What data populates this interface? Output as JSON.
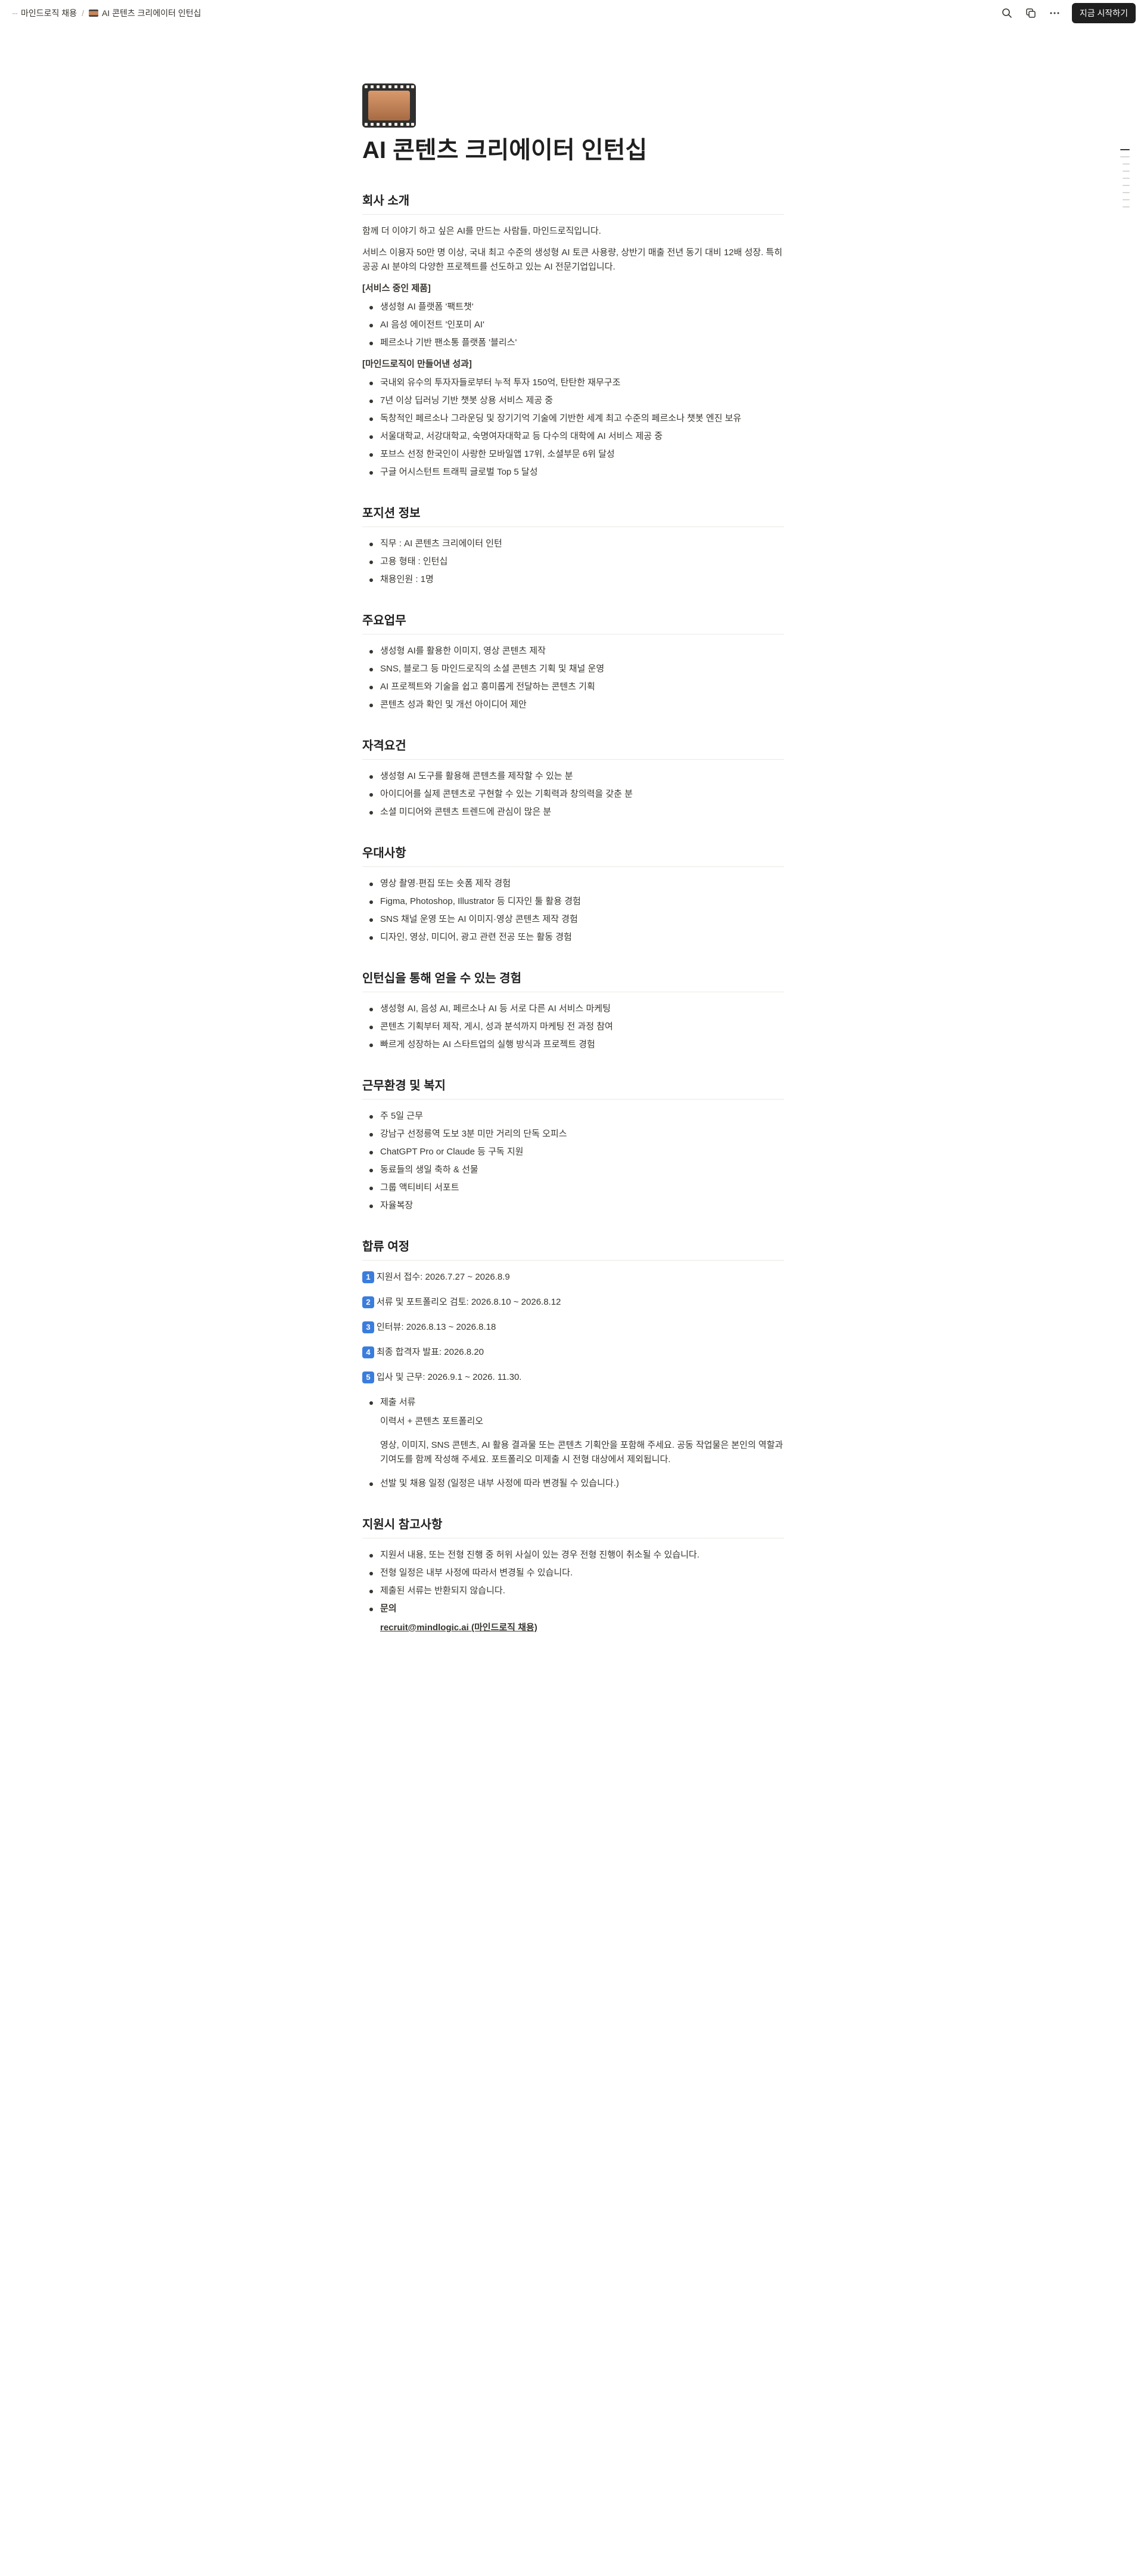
{
  "topbar": {
    "workspace": "마인드로직 채용",
    "page": "AI 콘텐츠 크리에이터 인턴십",
    "start_label": "지금 시작하기"
  },
  "page": {
    "title": "AI 콘텐츠 크리에이터 인턴십"
  },
  "company": {
    "heading": "회사 소개",
    "intro1": "함께 더 이야기 하고 싶은 AI를 만드는 사람들, 마인드로직입니다.",
    "intro2": "서비스 이용자 50만 명 이상, 국내 최고 수준의 생성형 AI 토큰 사용량, 상반기 매출 전년 동기 대비 12배 성장. 특히 공공 AI 분야의 다양한 프로젝트를 선도하고 있는 AI 전문기업입니다.",
    "services_label": "[서비스 중인 제품]",
    "services": [
      "생성형 AI 플랫폼 '팩트챗'",
      "AI 음성 에이전트 '인포미 AI'",
      "페르소나 기반 팬소통 플랫폼 '블리스'"
    ],
    "achievements_label": "[마인드로직이 만들어낸 성과]",
    "achievements": [
      "국내외 유수의 투자자들로부터 누적 투자 150억, 탄탄한 재무구조",
      "7년 이상 딥러닝 기반 챗봇 상용 서비스 제공 중",
      "독창적인 페르소나 그라운딩 및 장기기억 기술에 기반한 세계 최고 수준의 페르소나 챗봇 엔진 보유",
      "서울대학교, 서강대학교, 숙명여자대학교 등 다수의 대학에 AI 서비스 제공 중",
      "포브스 선정 한국인이 사랑한 모바일앱 17위, 소셜부문 6위 달성",
      "구글 어시스턴트 트래픽 글로벌 Top 5 달성"
    ]
  },
  "position": {
    "heading": "포지션 정보",
    "items": [
      "직무 : AI 콘텐츠 크리에이터 인턴",
      "고용 형태 : 인턴십",
      "채용인원 : 1명"
    ]
  },
  "duties": {
    "heading": "주요업무",
    "items": [
      "생성형 AI를 활용한 이미지, 영상 콘텐츠 제작",
      "SNS, 블로그 등 마인드로직의 소셜 콘텐츠 기획 및 채널 운영",
      "AI 프로젝트와 기술을 쉽고 흥미롭게 전달하는 콘텐츠 기획",
      "콘텐츠 성과 확인 및 개선 아이디어 제안"
    ]
  },
  "requirements": {
    "heading": "자격요건",
    "items": [
      "생성형 AI 도구를 활용해 콘텐츠를 제작할 수 있는 분",
      "아이디어를 실제 콘텐츠로 구현할 수 있는 기획력과 창의력을 갖춘 분",
      "소셜 미디어와 콘텐츠 트렌드에 관심이 많은 분"
    ]
  },
  "preferred": {
    "heading": "우대사항",
    "items": [
      "영상 촬영·편집 또는 숏폼 제작 경험",
      "Figma, Photoshop, Illustrator 등 디자인 툴 활용 경험",
      "SNS 채널 운영 또는 AI 이미지·영상 콘텐츠 제작 경험",
      "디자인, 영상, 미디어, 광고 관련 전공 또는 활동 경험"
    ]
  },
  "experience": {
    "heading": "인턴십을 통해 얻을 수 있는 경험",
    "items": [
      "생성형 AI, 음성 AI, 페르소나 AI 등 서로 다른 AI 서비스 마케팅",
      "콘텐츠 기획부터 제작, 게시, 성과 분석까지 마케팅 전 과정 참여",
      "빠르게 성장하는 AI 스타트업의 실행 방식과 프로젝트 경험"
    ]
  },
  "benefits": {
    "heading": "근무환경 및 복지",
    "items": [
      "주 5일 근무",
      "강남구 선정릉역 도보 3분 미만 거리의 단독 오피스",
      "ChatGPT Pro or Claude 등 구독 지원",
      "동료들의 생일 축하 & 선물",
      "그룹 액티비티 서포트",
      "자율복장"
    ]
  },
  "process": {
    "heading": "합류 여정",
    "steps": [
      {
        "num": "1",
        "text": "지원서 접수: 2026.7.27 ~ 2026.8.9"
      },
      {
        "num": "2",
        "text": "서류 및 포트폴리오 검토: 2026.8.10 ~ 2026.8.12"
      },
      {
        "num": "3",
        "text": "인터뷰: 2026.8.13 ~ 2026.8.18"
      },
      {
        "num": "4",
        "text": "최종 합격자 발표: 2026.8.20"
      },
      {
        "num": "5",
        "text": "입사 및 근무: 2026.9.1 ~ 2026. 11.30."
      }
    ],
    "docs_label": "제출 서류",
    "docs_value": "이력서 + 콘텐츠 포트폴리오",
    "docs_note": "영상, 이미지, SNS 콘텐츠, AI 활용 결과물 또는 콘텐츠 기획안을 포함해 주세요. 공동 작업물은 본인의 역할과 기여도를 함께 작성해 주세요. 포트폴리오 미제출 시 전형 대상에서 제외됩니다.",
    "schedule_note": "선발 및 채용 일정 (일정은 내부 사정에 따라 변경될 수 있습니다.)"
  },
  "notes": {
    "heading": "지원시 참고사항",
    "items": [
      "지원서 내용, 또는 전형 진행 중 허위 사실이 있는 경우 전형 진행이 취소될 수 있습니다.",
      "전형 일정은 내부 사정에 따라서 변경될 수 있습니다.",
      "제출된 서류는 반환되지 않습니다."
    ],
    "contact_label": "문의",
    "contact_value": "recruit@mindlogic.ai (마인드로직 채용)"
  }
}
